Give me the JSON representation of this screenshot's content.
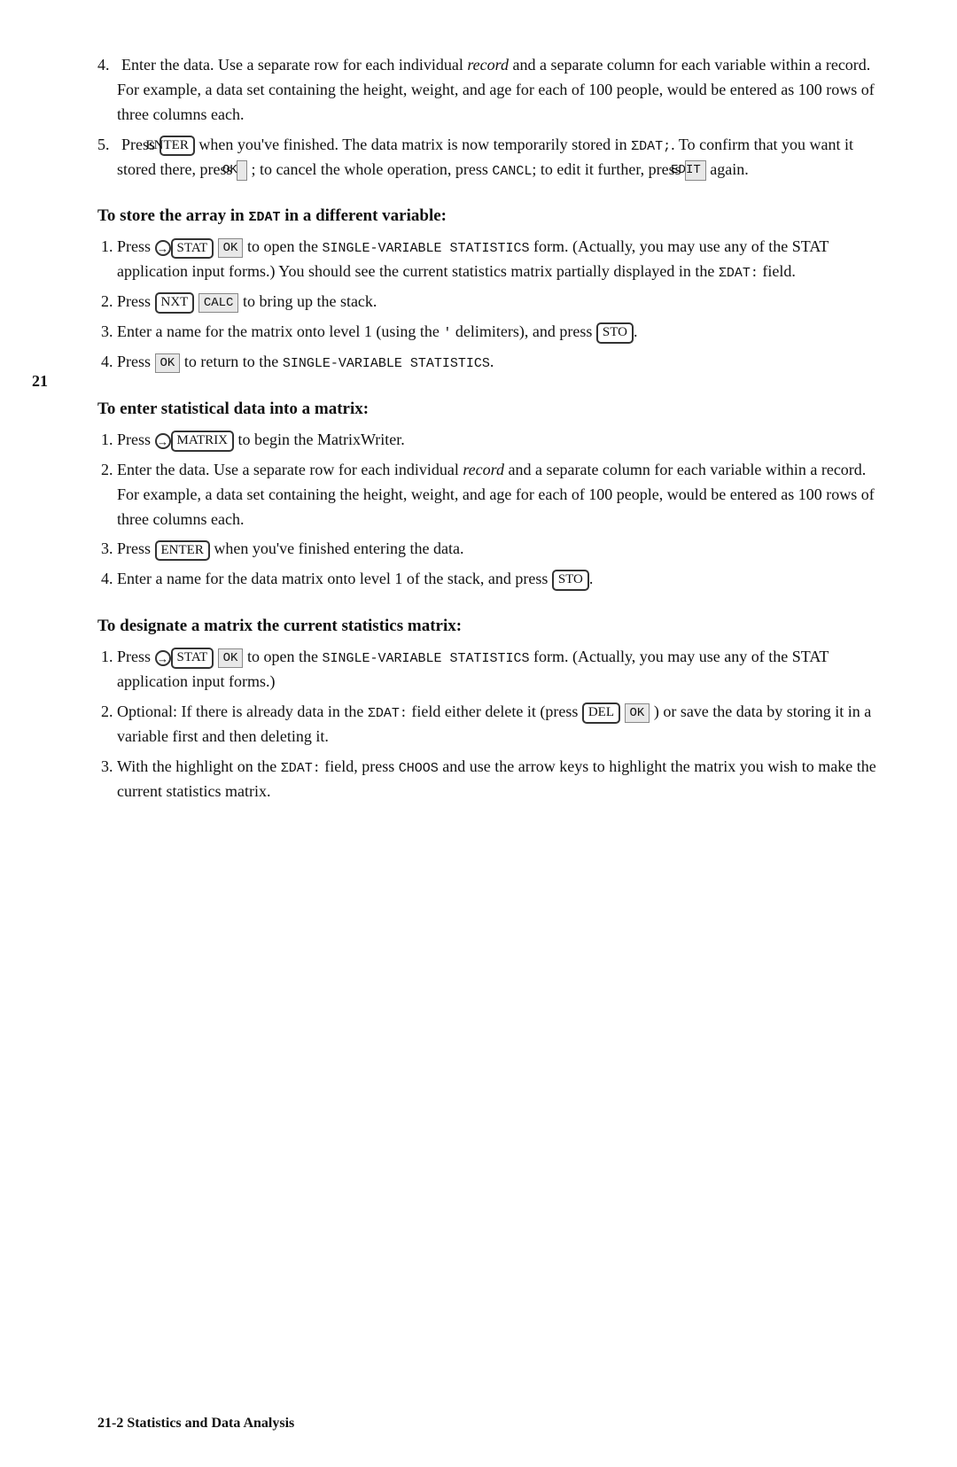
{
  "page_number": "21",
  "footer": "21-2  Statistics and Data Analysis",
  "intro_items": [
    {
      "num": "4.",
      "text": "Enter the data. Use a separate row for each individual record and a separate column for each variable within a record. For example, a data set containing the height, weight, and age for each of 100 people, would be entered as 100 rows of three columns each."
    },
    {
      "num": "5.",
      "text_parts": [
        "Press ",
        "ENTER",
        " when you've finished. The data matrix is now temporarily stored in ",
        "ΣDAT;",
        ". To confirm that you want it stored there, press ",
        "OK",
        "; to cancel the whole operation, press ",
        "CANCL",
        "; to edit it further, press ",
        "EDIT",
        " again."
      ]
    }
  ],
  "section1": {
    "heading": "To store the array in ΣDAT in a different variable:",
    "items": [
      {
        "num": "1",
        "text": "Press [→][STAT] OK to open the SINGLE-VARIABLE STATISTICS form. (Actually, you may use any of the STAT application input forms.) You should see the current statistics matrix partially displayed in the ΣDAT: field."
      },
      {
        "num": "2",
        "text": "Press [NXT] CALC to bring up the stack."
      },
      {
        "num": "3",
        "text": "Enter a name for the matrix onto level 1 (using the ' delimiters), and press [STO]."
      },
      {
        "num": "4",
        "text": "Press OK to return to the SINGLE-VARIABLE STATISTICS."
      }
    ]
  },
  "section2": {
    "heading": "To enter statistical data into a matrix:",
    "items": [
      {
        "num": "1",
        "text": "Press [→][MATRIX] to begin the MatrixWriter."
      },
      {
        "num": "2",
        "text": "Enter the data. Use a separate row for each individual record and a separate column for each variable within a record. For example, a data set containing the height, weight, and age for each of 100 people, would be entered as 100 rows of three columns each."
      },
      {
        "num": "3",
        "text": "Press [ENTER] when you've finished entering the data."
      },
      {
        "num": "4",
        "text": "Enter a name for the data matrix onto level 1 of the stack, and press [STO]."
      }
    ]
  },
  "section3": {
    "heading": "To designate a matrix the current statistics matrix:",
    "items": [
      {
        "num": "1",
        "text": "Press [→][STAT] OK to open the SINGLE-VARIABLE STATISTICS form. (Actually, you may use any of the STAT application input forms.)"
      },
      {
        "num": "2",
        "text": "Optional: If there is already data in the ΣDAT: field either delete it (press [DEL] OK ) or save the data by storing it in a variable first and then deleting it."
      },
      {
        "num": "3",
        "text": "With the highlight on the ΣDAT: field, press CHOOS and use the arrow keys to highlight the matrix you wish to make the current statistics matrix."
      }
    ]
  }
}
